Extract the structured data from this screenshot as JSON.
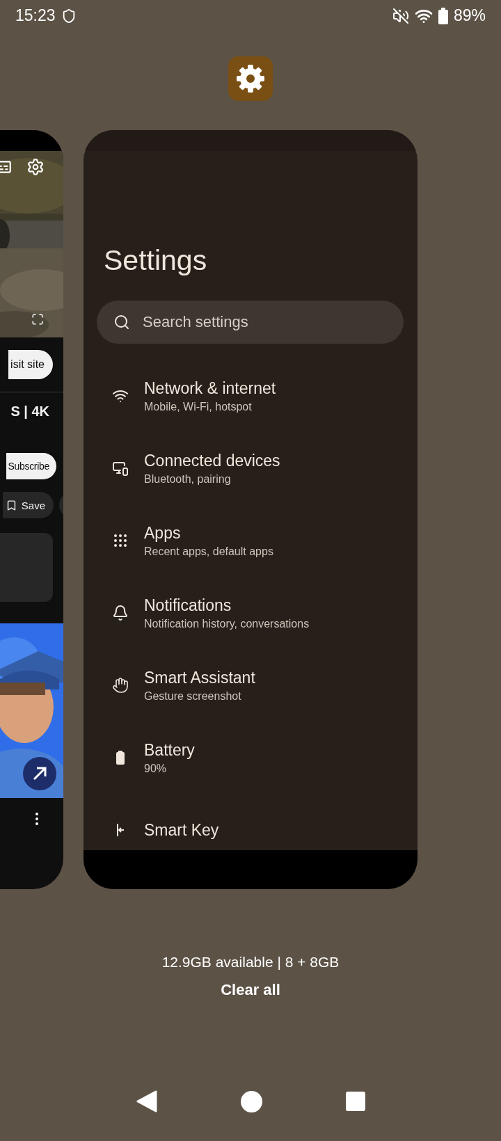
{
  "status_bar": {
    "time": "15:23",
    "battery": "89%"
  },
  "video_card": {
    "visit_button": "isit site",
    "video_title": "S | 4K",
    "subscribe_button": "Subscribe",
    "save_chip": "Save"
  },
  "settings_card": {
    "title": "Settings",
    "search": {
      "placeholder": "Search settings"
    },
    "items": [
      {
        "kind": "wifi",
        "title": "Network & internet",
        "subtitle": "Mobile, Wi-Fi, hotspot"
      },
      {
        "kind": "devices",
        "title": "Connected devices",
        "subtitle": "Bluetooth, pairing"
      },
      {
        "kind": "apps",
        "title": "Apps",
        "subtitle": "Recent apps, default apps"
      },
      {
        "kind": "bell",
        "title": "Notifications",
        "subtitle": "Notification history, conversations"
      },
      {
        "kind": "hand",
        "title": "Smart Assistant",
        "subtitle": "Gesture screenshot"
      },
      {
        "kind": "battery",
        "title": "Battery",
        "subtitle": "90%"
      },
      {
        "kind": "key",
        "title": "Smart Key"
      }
    ]
  },
  "memory": "12.9GB available | 8 + 8GB",
  "clear_all": "Clear all"
}
